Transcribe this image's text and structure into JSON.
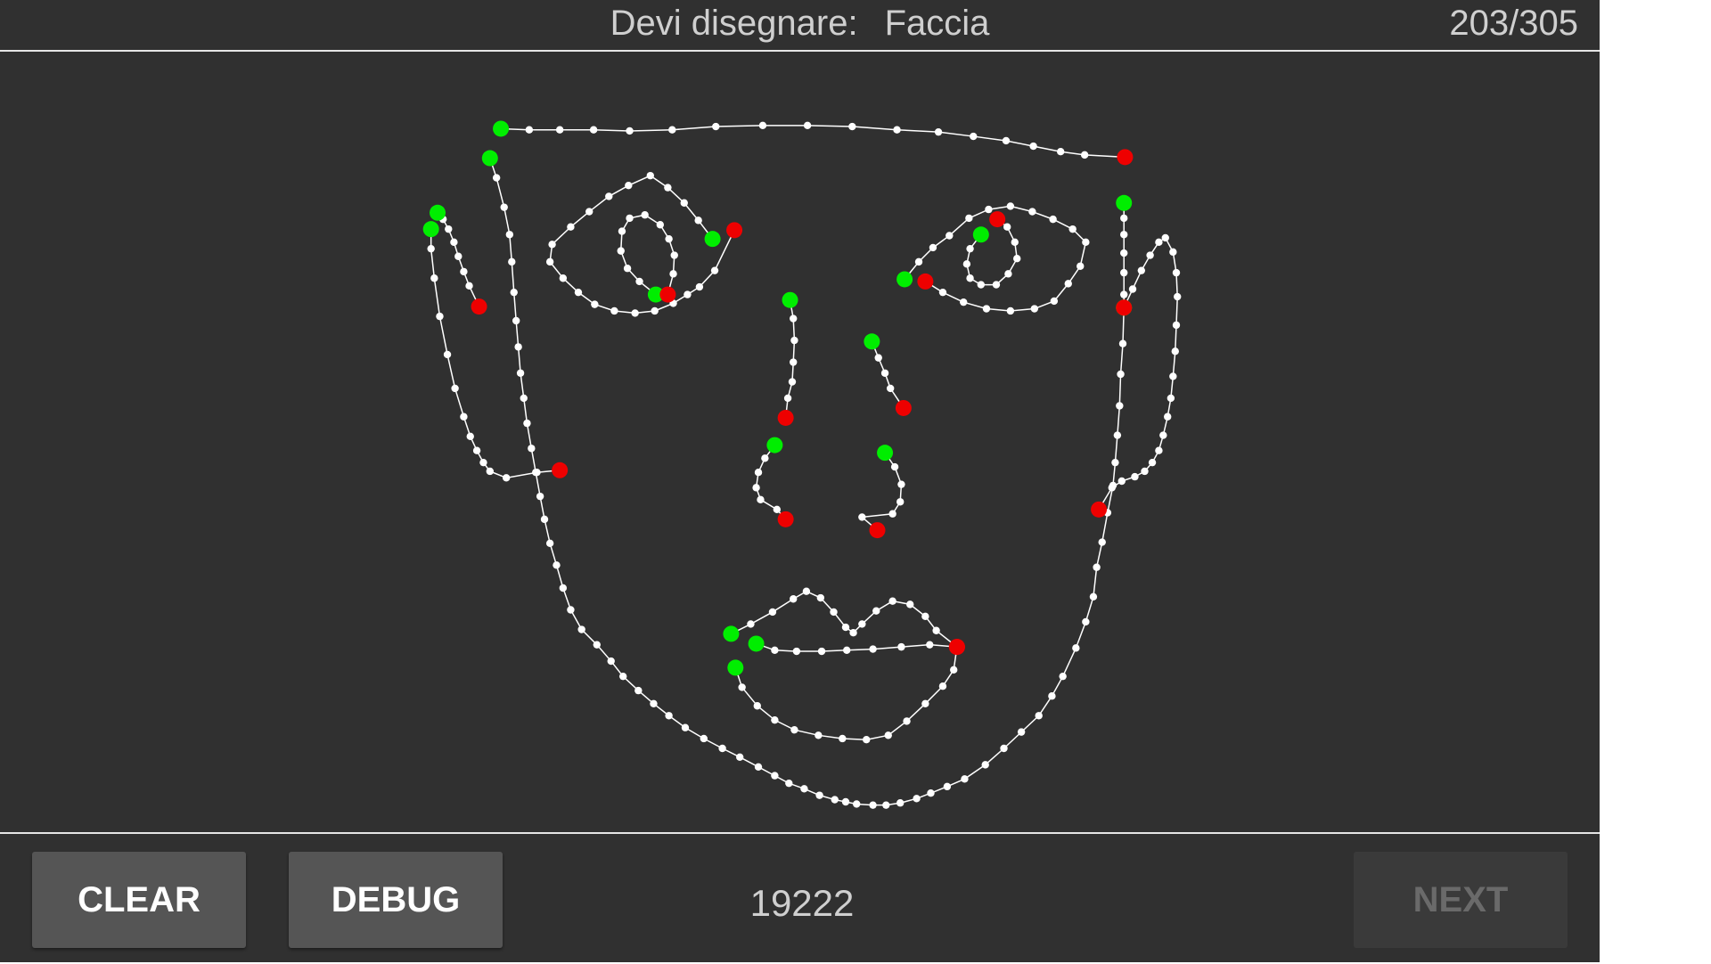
{
  "header": {
    "prompt_label": "Devi disegnare:",
    "prompt_value": "Faccia",
    "progress": "203/305"
  },
  "footer": {
    "clear_label": "CLEAR",
    "debug_label": "DEBUG",
    "score": "19222",
    "next_label": "NEXT",
    "next_enabled": false
  },
  "colors": {
    "background": "#303030",
    "stroke": "#ffffff",
    "stroke_start": "#00ee00",
    "stroke_end": "#ee0000",
    "button": "#555555",
    "button_disabled": "#3a3a3a"
  }
}
